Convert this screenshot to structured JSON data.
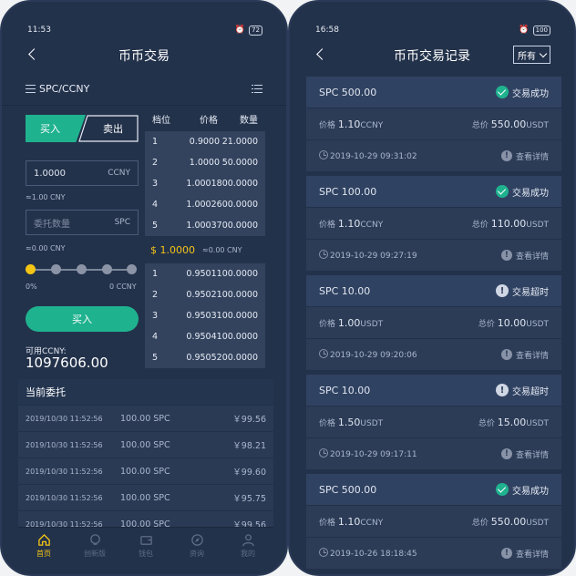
{
  "left": {
    "status_time": "11:53",
    "battery": "72",
    "title": "币币交易",
    "pair": "SPC/CCNY",
    "tabs": {
      "buy": "买入",
      "sell": "卖出"
    },
    "price_input": {
      "value": "1.0000",
      "unit": "CCNY"
    },
    "price_hint": "≈1.00 CNY",
    "amount_input": {
      "placeholder": "委托数量",
      "unit": "SPC"
    },
    "amount_hint": "≈0.00 CNY",
    "slider": {
      "min_label": "0%",
      "max_label": "0 CCNY",
      "level": 0
    },
    "buy_button": "买入",
    "available_label": "可用CCNY:",
    "available_value": "1097606.00",
    "book_headers": {
      "level": "档位",
      "price": "价格",
      "quantity": "数量"
    },
    "asks": [
      {
        "level": "1",
        "price": "0.9000",
        "qty": "21.0000"
      },
      {
        "level": "2",
        "price": "1.0000",
        "qty": "50.0000"
      },
      {
        "level": "3",
        "price": "1.0001",
        "qty": "800.0000"
      },
      {
        "level": "4",
        "price": "1.0002",
        "qty": "600.0000"
      },
      {
        "level": "5",
        "price": "1.0003",
        "qty": "700.0000"
      }
    ],
    "mid_price": "$ 1.0000",
    "mid_cny": "≈0.00 CNY",
    "bids": [
      {
        "level": "1",
        "price": "0.9501",
        "qty": "100.0000"
      },
      {
        "level": "2",
        "price": "0.9502",
        "qty": "100.0000"
      },
      {
        "level": "3",
        "price": "0.9503",
        "qty": "100.0000"
      },
      {
        "level": "4",
        "price": "0.9504",
        "qty": "100.0000"
      },
      {
        "level": "5",
        "price": "0.9505",
        "qty": "200.0000"
      }
    ],
    "orders_title": "当前委托",
    "orders": [
      {
        "time": "2019/10/30 11:52:56",
        "qty": "100.00 SPC",
        "price": "￥99.56"
      },
      {
        "time": "2019/10/30 11:52:56",
        "qty": "100.00 SPC",
        "price": "￥98.21"
      },
      {
        "time": "2019/10/30 11:52:56",
        "qty": "100.00 SPC",
        "price": "￥99.60"
      },
      {
        "time": "2019/10/30 11:52:56",
        "qty": "100.00 SPC",
        "price": "￥95.75"
      },
      {
        "time": "2019/10/30 11:52:56",
        "qty": "100.00 SPC",
        "price": "￥99.56"
      }
    ],
    "tabbar": [
      {
        "label": "首页",
        "icon": "home-icon",
        "active": true
      },
      {
        "label": "创新版",
        "icon": "bulb-icon",
        "active": false
      },
      {
        "label": "钱包",
        "icon": "wallet-icon",
        "active": false
      },
      {
        "label": "资询",
        "icon": "compass-icon",
        "active": false
      },
      {
        "label": "我的",
        "icon": "user-icon",
        "active": false
      }
    ],
    "colors": {
      "accent_green": "#1fb28f",
      "accent_yellow": "#f4c515",
      "background": "#23324b"
    }
  },
  "right": {
    "status_time": "16:58",
    "battery": "100",
    "title": "币币交易记录",
    "filter": "所有",
    "price_label": "价格",
    "total_label": "总价",
    "detail_label": "查看详情",
    "records": [
      {
        "amount": "SPC 500.00",
        "status": "交易成功",
        "ok": true,
        "price": "1.10",
        "price_unit": "CCNY",
        "total": "550.00",
        "total_unit": "USDT",
        "time": "2019-10-29 09:31:02"
      },
      {
        "amount": "SPC 100.00",
        "status": "交易成功",
        "ok": true,
        "price": "1.10",
        "price_unit": "CCNY",
        "total": "110.00",
        "total_unit": "USDT",
        "time": "2019-10-29 09:27:19"
      },
      {
        "amount": "SPC 10.00",
        "status": "交易超时",
        "ok": false,
        "price": "1.00",
        "price_unit": "USDT",
        "total": "10.00",
        "total_unit": "USDT",
        "time": "2019-10-29 09:20:06"
      },
      {
        "amount": "SPC 10.00",
        "status": "交易超时",
        "ok": false,
        "price": "1.50",
        "price_unit": "USDT",
        "total": "15.00",
        "total_unit": "USDT",
        "time": "2019-10-29 09:17:11"
      },
      {
        "amount": "SPC 500.00",
        "status": "交易成功",
        "ok": true,
        "price": "1.10",
        "price_unit": "CCNY",
        "total": "550.00",
        "total_unit": "USDT",
        "time": "2019-10-26 18:18:45"
      }
    ]
  }
}
